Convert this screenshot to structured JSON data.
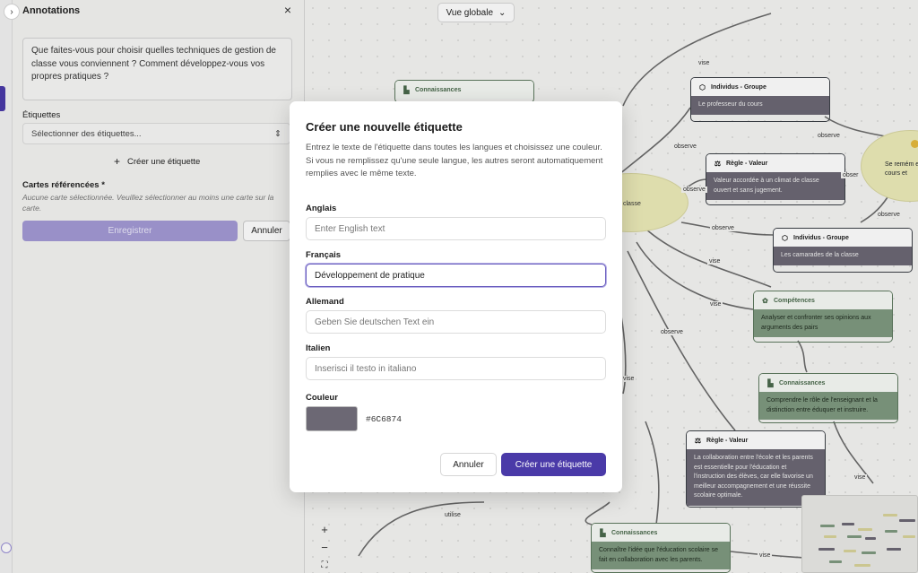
{
  "sidebar": {
    "title": "Annotations",
    "toggle_icon": "›",
    "close_icon": "×",
    "question_text": "Que faites-vous pour choisir quelles techniques de gestion de classe vous conviennent ? Comment développez-vous vos propres pratiques ?",
    "tags_label": "Étiquettes",
    "tags_select": "Sélectionner des étiquettes...",
    "create_tag_icon": "+",
    "create_tag": "Créer une étiquette",
    "referenced_cards_label": "Cartes référencées *",
    "referenced_cards_hint": "Aucune carte sélectionnée. Veuillez sélectionner au moins une carte sur la carte.",
    "save_button": "Enregistrer",
    "cancel_button": "Annuler"
  },
  "canvas": {
    "view_select": "Vue globale",
    "edge_labels": {
      "vise_1": "vise",
      "observe_1": "observe",
      "observe_2": "observe",
      "observe_3": "observe",
      "observe_4": "observe",
      "observe_5": "observe",
      "observe_6": "observe",
      "vise_2": "vise",
      "vise_3": "vise",
      "vise_4": "vise",
      "vise_5": "vise",
      "vise_6": "vise",
      "utilise": "utilise",
      "classe_frag": "classe",
      "obser_frag": "obser"
    },
    "nodes": {
      "connaissances_top": {
        "title": "Connaissances"
      },
      "individus_1": {
        "title": "Individus - Groupe",
        "body": "Le professeur du cours"
      },
      "regle_1": {
        "title": "Règle - Valeur",
        "body": "Valeur accordée à un climat de classe ouvert et sans jugement."
      },
      "individus_2": {
        "title": "Individus - Groupe",
        "body": "Les camarades de la classe"
      },
      "competences": {
        "title": "Compétences",
        "body": "Analyser et confronter ses opinions aux arguments des pairs"
      },
      "connaissances_2": {
        "title": "Connaissances",
        "body": "Comprendre le rôle de l'enseignant et la distinction entre éduquer et instruire."
      },
      "regle_2": {
        "title": "Règle - Valeur",
        "body": "La collaboration entre l'école et les parents est essentielle pour l'éducation et l'instruction des élèves, car elle favorise un meilleur accompagnement et une réussite scolaire optimale."
      },
      "connaissances_3": {
        "title": "Connaissances",
        "body": "Connaître l'idée que l'éducation scolaire se fait en collaboration avec les parents."
      },
      "partial_right": {
        "body": "Se remém en cours et"
      }
    },
    "zoom": {
      "in": "+",
      "out": "−",
      "fit": "⛶"
    }
  },
  "modal": {
    "title": "Créer une nouvelle étiquette",
    "description": "Entrez le texte de l'étiquette dans toutes les langues et choisissez une couleur. Si vous ne remplissez qu'une seule langue, les autres seront automatiquement remplies avec le même texte.",
    "fields": {
      "english": {
        "label": "Anglais",
        "value": "",
        "placeholder": "Enter English text"
      },
      "french": {
        "label": "Français",
        "value": "Développement de pratique",
        "placeholder": ""
      },
      "german": {
        "label": "Allemand",
        "value": "",
        "placeholder": "Geben Sie deutschen Text ein"
      },
      "italian": {
        "label": "Italien",
        "value": "",
        "placeholder": "Inserisci il testo in italiano"
      }
    },
    "color_label": "Couleur",
    "color_value": "#6C6874",
    "cancel_button": "Annuler",
    "create_button": "Créer une étiquette"
  },
  "colors": {
    "accent": "#4a3aa8",
    "tag_color": "#6C6874",
    "node_gray": "#6c6874",
    "node_green": "#7f9a80"
  }
}
